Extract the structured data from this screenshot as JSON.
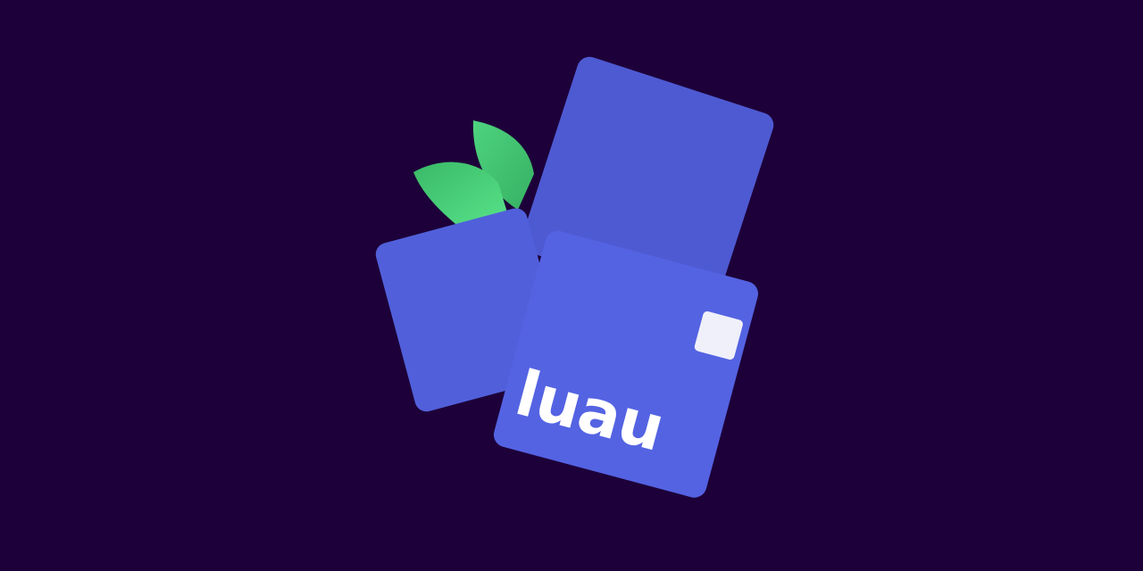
{
  "logo": {
    "wordmark": "luau",
    "colors": {
      "background": "#1d0039",
      "square_back": "#4e5ad2",
      "square_left": "#5160da",
      "square_front": "#5463e2",
      "leaf_light": "#56df85",
      "leaf_dark": "#38b965",
      "notch": "#f0f0fb",
      "wordmark": "#ffffff"
    }
  }
}
